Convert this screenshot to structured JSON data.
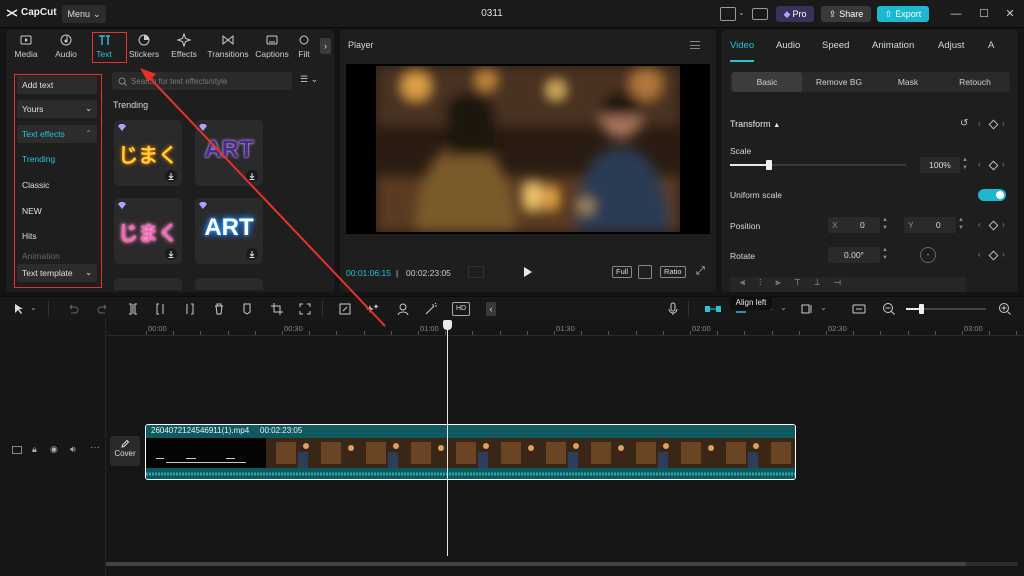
{
  "app": {
    "logo_text": "CapCut",
    "menu_label": "Menu",
    "project_name": "0311",
    "pro_label": "Pro",
    "share_label": "Share",
    "export_label": "Export"
  },
  "toolbar": {
    "tabs": [
      {
        "label": "Media",
        "icon": "media-icon"
      },
      {
        "label": "Audio",
        "icon": "audio-icon"
      },
      {
        "label": "Text",
        "icon": "text-icon",
        "active": true
      },
      {
        "label": "Stickers",
        "icon": "stickers-icon"
      },
      {
        "label": "Effects",
        "icon": "effects-icon"
      },
      {
        "label": "Transitions",
        "icon": "transitions-icon"
      },
      {
        "label": "Captions",
        "icon": "captions-icon"
      },
      {
        "label": "Filt",
        "icon": "filters-icon"
      }
    ]
  },
  "text_panel": {
    "categories": [
      {
        "label": "Add text"
      },
      {
        "label": "Yours"
      },
      {
        "label": "Text effects"
      },
      {
        "label": "Trending"
      },
      {
        "label": "Classic"
      },
      {
        "label": "NEW"
      },
      {
        "label": "Hits"
      },
      {
        "label": "Animation"
      },
      {
        "label": "Text template"
      }
    ],
    "search_placeholder": "Search for text effects/style",
    "section_title": "Trending",
    "effects": [
      {
        "text": "じまく",
        "style": "gold"
      },
      {
        "text": "ART",
        "style": "purple"
      },
      {
        "text": "じまく",
        "style": "pink"
      },
      {
        "text": "ART",
        "style": "blue"
      }
    ]
  },
  "player": {
    "title": "Player",
    "time_current": "00:01:06:15",
    "time_separator": "|",
    "time_total": "00:02:23:05",
    "full_label": "Full",
    "ratio_label": "Ratio"
  },
  "inspector": {
    "tabs": [
      "Video",
      "Audio",
      "Speed",
      "Animation",
      "Adjust",
      "A"
    ],
    "subtabs": [
      "Basic",
      "Remove BG",
      "Mask",
      "Retouch"
    ],
    "transform_label": "Transform",
    "scale_label": "Scale",
    "scale_value": "100%",
    "scale_fraction": 1.0,
    "uniform_scale_label": "Uniform scale",
    "position_label": "Position",
    "pos_x_label": "X",
    "pos_x_value": "0",
    "pos_y_label": "Y",
    "pos_y_value": "0",
    "rotate_label": "Rotate",
    "rotate_value": "0.00°"
  },
  "timeline": {
    "tooltip": "Align left",
    "ticks": [
      "00:00",
      "00:30",
      "01:00",
      "01:30",
      "02:00",
      "02:30",
      "03:00"
    ],
    "cover_label": "Cover",
    "clip_name": "260407212454691​1(1).mp4",
    "clip_duration": "00:02:23:05"
  },
  "colors": {
    "accent": "#26c3d9",
    "export": "#1cb8cf",
    "annotation": "#e5322d",
    "clip": "#0e4c52"
  }
}
